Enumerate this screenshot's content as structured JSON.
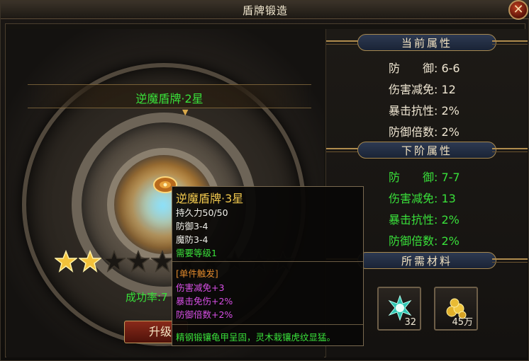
{
  "window": {
    "title": "盾牌锻造",
    "close_label": "✕"
  },
  "item": {
    "name": "逆魔盾牌·2星",
    "stars_total": 10,
    "stars_filled": 2,
    "success_label": "成功率:7",
    "upgrade_label": "升级"
  },
  "current": {
    "header": "当前属性",
    "rows": [
      "防　　御: 6-6",
      "伤害减免: 12",
      "暴击抗性: 2%",
      "防御倍数: 2%"
    ]
  },
  "next": {
    "header": "下阶属性",
    "rows": [
      "防　　御: 7-7",
      "伤害减免: 13",
      "暴击抗性: 2%",
      "防御倍数: 2%"
    ]
  },
  "materials": {
    "header": "所需材料",
    "items": [
      {
        "icon": "crystal-icon",
        "count": "32"
      },
      {
        "icon": "gold-coins-icon",
        "count": "45万"
      }
    ]
  },
  "tooltip": {
    "title": "逆魔盾牌·3星",
    "durability": "持久力50/50",
    "defense": "防御3-4",
    "magic_defense": "魔防3-4",
    "level_req": "需要等级1",
    "trigger_header": "[单件触发]",
    "effects": [
      "伤害减免+3",
      "暴击免伤+2%",
      "防御倍数+2%"
    ],
    "description": "精钢锻镶龟甲呈固，灵木栽镶虎纹显猛。"
  },
  "colors": {
    "green": "#39e03a",
    "gold": "#f1c84d",
    "purple": "#d84fe6",
    "orange": "#e0892c"
  }
}
